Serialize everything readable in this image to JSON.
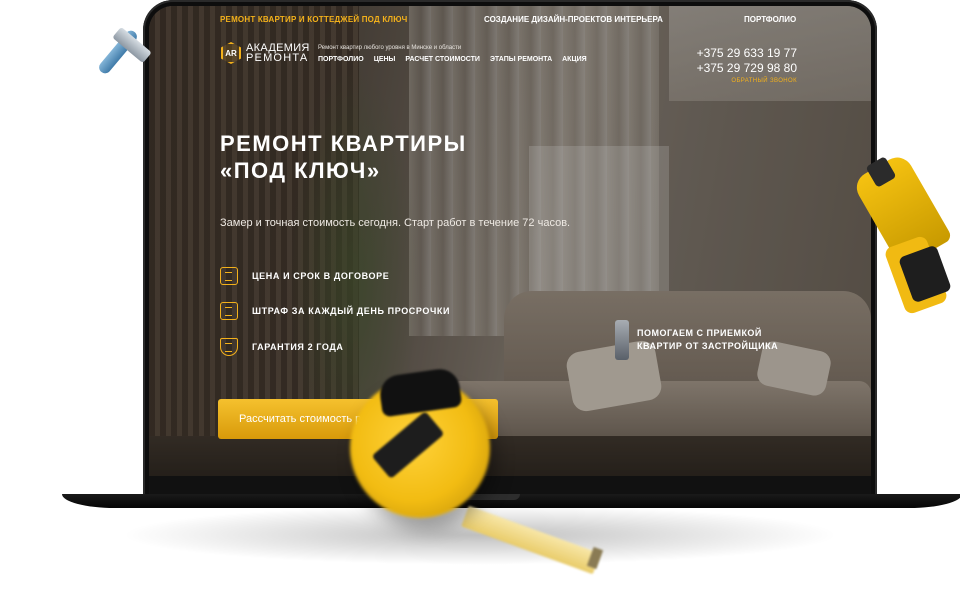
{
  "topbar": {
    "left": "РЕМОНТ КВАРТИР И КОТТЕДЖЕЙ ПОД КЛЮЧ",
    "middle": "СОЗДАНИЕ ДИЗАЙН-ПРОЕКТОВ ИНТЕРЬЕРА",
    "right": "ПОРТФОЛИО"
  },
  "logo": {
    "mark": "AR",
    "line1": "АКАДЕМИЯ",
    "line2": "РЕМОНТА"
  },
  "header": {
    "tagline": "Ремонт квартир любого уровня в Минске и области",
    "nav": [
      "ПОРТФОЛИО",
      "ЦЕНЫ",
      "РАСЧЕТ СТОИМОСТИ",
      "ЭТАПЫ РЕМОНТА",
      "АКЦИЯ"
    ],
    "phones": [
      "+375 29 633 19 77",
      "+375 29 729 98 80"
    ],
    "callback": "ОБРАТНЫЙ ЗВОНОК"
  },
  "hero": {
    "title_line1": "РЕМОНТ КВАРТИРЫ",
    "title_line2": "«ПОД КЛЮЧ»",
    "subtitle": "Замер и точная стоимость сегодня. Старт работ в течение 72 часов.",
    "features": [
      "ЦЕНА И СРОК В ДОГОВОРЕ",
      "ШТРАФ ЗА КАЖДЫЙ ДЕНЬ ПРОСРОЧКИ",
      "ГАРАНТИЯ 2 ГОДА"
    ],
    "promo_line1": "ПОМОГАЕМ С ПРИЕМКОЙ",
    "promo_line2": "КВАРТИР ОТ ЗАСТРОЙЩИКА",
    "cta": "Рассчитать стоимость р"
  },
  "colors": {
    "accent": "#f3b11b",
    "text": "#ffffff"
  }
}
